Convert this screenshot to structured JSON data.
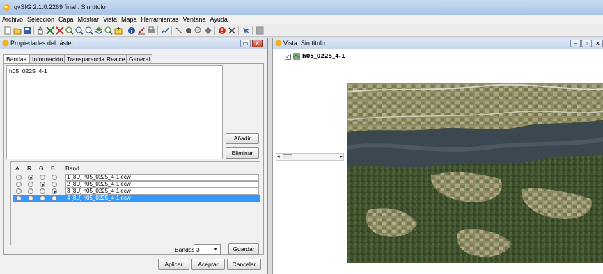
{
  "app": {
    "title": "gvSIG 2.1.0.2269 final : Sin título",
    "icon": "gvsig-app-icon"
  },
  "menu": [
    "Archivo",
    "Selección",
    "Capa",
    "Mostrar",
    "Vista",
    "Mapa",
    "Herramientas",
    "Ventana",
    "Ayuda"
  ],
  "toolbar": {
    "icons": [
      "new-doc-icon",
      "open-folder-icon",
      "save-icon",
      "pan-hand-icon",
      "zoom-full-icon",
      "zoom-extent-icon",
      "zoom-in-icon",
      "zoom-out-icon",
      "zoom-layer-icon",
      "layers-icon",
      "zoom-select-icon",
      "add-layer-icon",
      "info-icon",
      "measure-icon",
      "print-icon",
      "graph-icon",
      "vertex-icon",
      "point-icon",
      "zoom-point-icon",
      "node-icon",
      "warning-icon",
      "tools-icon",
      "select-tool-icon",
      "gray-square-icon"
    ]
  },
  "properties_dialog": {
    "title": "Propiedades del ráster",
    "tabs": [
      "Bandas",
      "Información",
      "Transparencia",
      "Realce",
      "General"
    ],
    "active_tab": "Bandas",
    "files": [
      "h05_0225_4-1"
    ],
    "add_button": "Añadir",
    "remove_button": "Eliminar",
    "band_headers": [
      "A",
      "R",
      "G",
      "B",
      "Band"
    ],
    "band_rows": [
      {
        "band": "1 [8U] h05_0225_4-1.ecw",
        "r": true,
        "g": false,
        "b": false,
        "selected": false
      },
      {
        "band": "2 [8U] h05_0225_4-1.ecw",
        "r": false,
        "g": true,
        "b": false,
        "selected": false
      },
      {
        "band": "3 [8U] h05_0225_4-1.ecw",
        "r": false,
        "g": false,
        "b": true,
        "selected": false
      },
      {
        "band": "4 [8U] h05_0225_4-1.ecw",
        "r": false,
        "g": false,
        "b": false,
        "selected": true
      }
    ],
    "bands_label": "Bandas",
    "bands_value": "3",
    "save_button": "Guardar",
    "apply_button": "Aplicar",
    "accept_button": "Aceptar",
    "cancel_button": "Cancelar"
  },
  "view_window": {
    "title": "Vista: Sin título",
    "layer_name": "h05_0225_4-1",
    "layer_checked": true,
    "map_description_colors": {
      "river": "#3c4850",
      "forest": "#3e4f2e",
      "fields": "#9a9672",
      "road": "#d8d4c8"
    }
  }
}
